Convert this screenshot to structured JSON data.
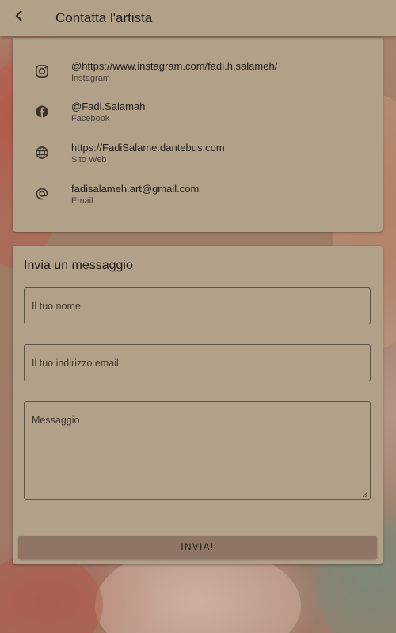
{
  "app_bar": {
    "title": "Contatta l'artista",
    "back_icon": "arrow-back-icon"
  },
  "contacts": [
    {
      "icon": "instagram-icon",
      "value": "@https://www.instagram.com/fadi.h.salameh/",
      "label": "Instagram"
    },
    {
      "icon": "facebook-icon",
      "value": "@Fadi.Salamah",
      "label": "Facebook"
    },
    {
      "icon": "globe-icon",
      "value": "https://FadiSalame.dantebus.com",
      "label": "Sito Web"
    },
    {
      "icon": "at-sign-icon",
      "value": "fadisalameh.art@gmail.com",
      "label": "Email"
    }
  ],
  "form": {
    "title": "Invia un messaggio",
    "name_placeholder": "Il tuo nome",
    "email_placeholder": "Il tuo indirizzo email",
    "message_placeholder": "Messaggio",
    "name_value": "",
    "email_value": "",
    "message_value": "",
    "submit_label": "INVIA!"
  },
  "colors": {
    "surface": "#b1a189",
    "button": "#8e7565",
    "text": "#1f1b16"
  }
}
